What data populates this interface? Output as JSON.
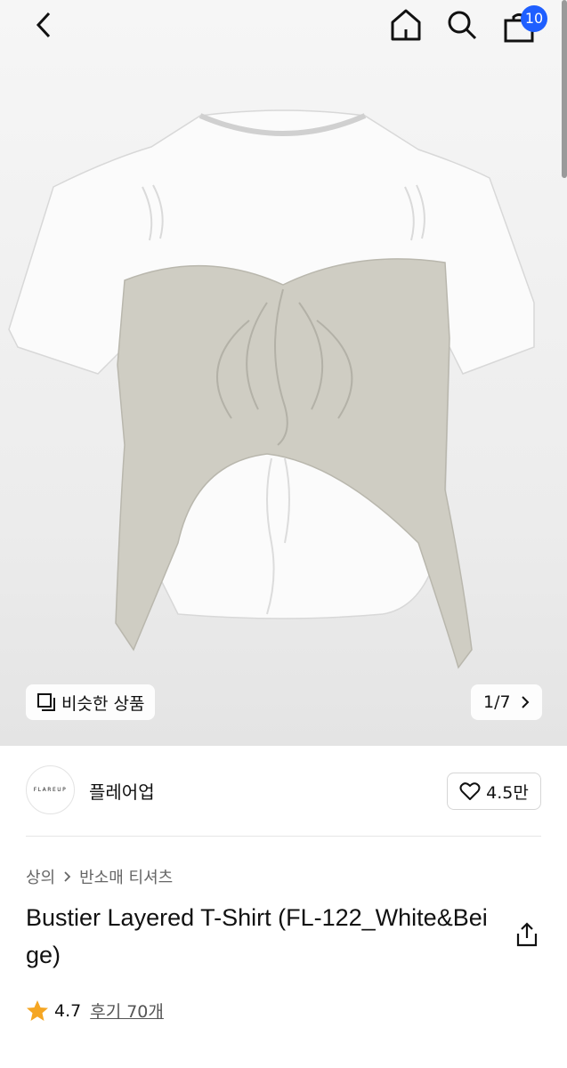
{
  "header": {
    "cart_count": "10",
    "icons": [
      "back-icon",
      "home-icon",
      "search-icon",
      "cart-icon"
    ]
  },
  "gallery": {
    "similar_label": "비슷한 상품",
    "counter": "1/7"
  },
  "brand": {
    "logo_text": "FLAREUP",
    "name": "플레어업",
    "likes": "4.5만"
  },
  "breadcrumb": {
    "level1": "상의",
    "level2": "반소매 티셔츠"
  },
  "product": {
    "title": "Bustier Layered T-Shirt (FL-122_White&Beige)"
  },
  "review": {
    "rating": "4.7",
    "count_label": "후기 70개"
  },
  "colors": {
    "badge": "#1f5fff",
    "star": "#f5a623"
  }
}
